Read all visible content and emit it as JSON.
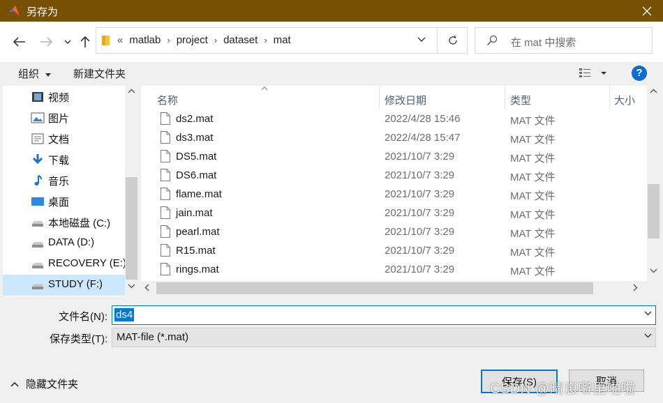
{
  "window": {
    "title": "另存为"
  },
  "address": {
    "overflow": "«",
    "crumbs": [
      "matlab",
      "project",
      "dataset",
      "mat"
    ]
  },
  "search": {
    "placeholder": "在 mat 中搜索"
  },
  "toolbar": {
    "organize": "组织",
    "new_folder": "新建文件夹",
    "help": "?"
  },
  "sidebar": {
    "items": [
      {
        "label": "视频",
        "icon": "video-icon"
      },
      {
        "label": "图片",
        "icon": "pictures-icon"
      },
      {
        "label": "文档",
        "icon": "documents-icon"
      },
      {
        "label": "下载",
        "icon": "download-icon"
      },
      {
        "label": "音乐",
        "icon": "music-icon"
      },
      {
        "label": "桌面",
        "icon": "desktop-icon"
      },
      {
        "label": "本地磁盘 (C:)",
        "icon": "drive-icon"
      },
      {
        "label": "DATA (D:)",
        "icon": "drive-icon"
      },
      {
        "label": "RECOVERY (E:)",
        "icon": "drive-icon"
      },
      {
        "label": "STUDY (F:)",
        "icon": "drive-icon",
        "selected": true
      }
    ]
  },
  "files": {
    "columns": [
      "名称",
      "修改日期",
      "类型",
      "大小"
    ],
    "rows": [
      {
        "name": "ds2.mat",
        "date": "2022/4/28 15:46",
        "type": "MAT 文件"
      },
      {
        "name": "ds3.mat",
        "date": "2022/4/28 15:47",
        "type": "MAT 文件"
      },
      {
        "name": "DS5.mat",
        "date": "2021/10/7 3:29",
        "type": "MAT 文件"
      },
      {
        "name": "DS6.mat",
        "date": "2021/10/7 3:29",
        "type": "MAT 文件"
      },
      {
        "name": "flame.mat",
        "date": "2021/10/7 3:29",
        "type": "MAT 文件"
      },
      {
        "name": "jain.mat",
        "date": "2021/10/7 3:29",
        "type": "MAT 文件"
      },
      {
        "name": "pearl.mat",
        "date": "2021/10/7 3:29",
        "type": "MAT 文件"
      },
      {
        "name": "R15.mat",
        "date": "2021/10/7 3:29",
        "type": "MAT 文件"
      },
      {
        "name": "rings.mat",
        "date": "2021/10/7 3:29",
        "type": "MAT 文件"
      }
    ]
  },
  "form": {
    "filename_label": "文件名(N):",
    "filename_value": "ds4",
    "filetype_label": "保存类型(T):",
    "filetype_value": "MAT-file (*.mat)"
  },
  "footer": {
    "hide_folders": "隐藏文件夹",
    "save": "保存(S)",
    "cancel": "取消",
    "watermark": "CSDN @晴崽噼里啪啦"
  },
  "colors": {
    "titlebar": "#775004",
    "accent": "#0078d7",
    "selection": "#cce8ff"
  }
}
